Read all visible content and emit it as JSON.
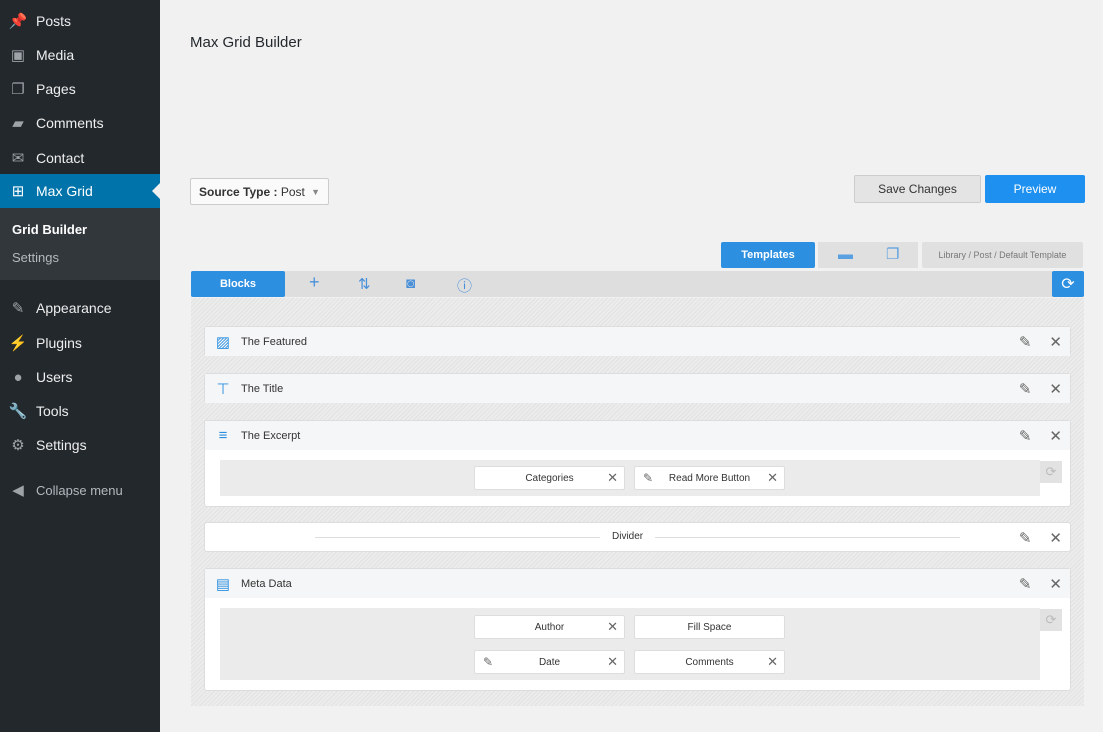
{
  "sidebar": {
    "items": [
      {
        "label": "Posts",
        "icon": "pin-icon"
      },
      {
        "label": "Media",
        "icon": "media-icon"
      },
      {
        "label": "Pages",
        "icon": "pages-icon"
      },
      {
        "label": "Comments",
        "icon": "comment-icon"
      },
      {
        "label": "Contact",
        "icon": "mail-icon"
      },
      {
        "label": "Max Grid",
        "icon": "grid-icon"
      },
      {
        "label": "Appearance",
        "icon": "brush-icon"
      },
      {
        "label": "Plugins",
        "icon": "plugin-icon"
      },
      {
        "label": "Users",
        "icon": "user-icon"
      },
      {
        "label": "Tools",
        "icon": "wrench-icon"
      },
      {
        "label": "Settings",
        "icon": "settings-icon"
      }
    ],
    "submenu": [
      "Grid Builder",
      "Settings"
    ],
    "collapse": "Collapse menu"
  },
  "page": {
    "title": "Max Grid Builder",
    "source_label": "Source Type :",
    "source_value": "Post",
    "save": "Save Changes",
    "preview": "Preview"
  },
  "templates": {
    "tab": "Templates",
    "breadcrumb": "Library / Post / Default Template"
  },
  "toolbar": {
    "blocks": "Blocks"
  },
  "blocks": [
    {
      "title": "The Featured"
    },
    {
      "title": "The Title"
    },
    {
      "title": "The Excerpt",
      "chips": [
        "Categories",
        "Read More Button"
      ]
    },
    {
      "title": "Divider"
    },
    {
      "title": "Meta Data",
      "chips": [
        "Author",
        "Fill Space",
        "Date",
        "Comments"
      ]
    }
  ],
  "colors": {
    "accent": "#2d8fe0",
    "sidebar": "#23282d",
    "active": "#0073aa"
  }
}
